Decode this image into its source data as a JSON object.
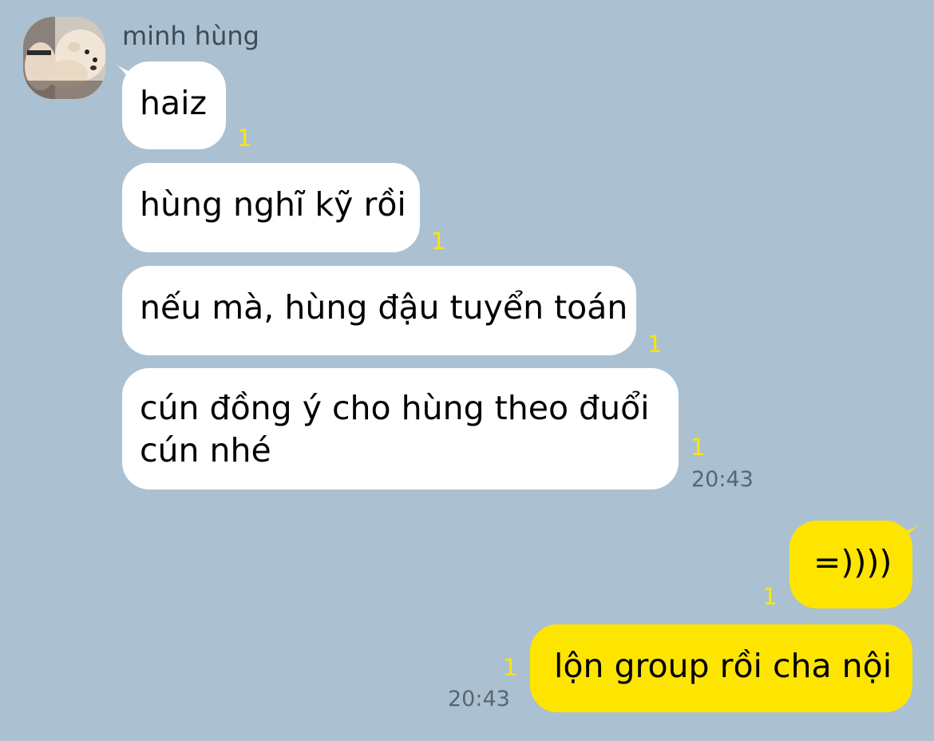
{
  "chat": {
    "sender_name": "minh hùng",
    "incoming": [
      {
        "text": "haiz",
        "unread": "1"
      },
      {
        "text": "hùng nghĩ kỹ rồi",
        "unread": "1"
      },
      {
        "text": "nếu mà, hùng đậu tuyển toán",
        "unread": "1"
      },
      {
        "text": "cún đồng ý cho hùng theo đuổi",
        "text2": "cún nhé",
        "unread": "1",
        "time": "20:43"
      }
    ],
    "outgoing": [
      {
        "text": "=))))",
        "unread": "1"
      },
      {
        "text": "lộn group rồi cha nội",
        "unread": "1",
        "time": "20:43"
      }
    ]
  },
  "colors": {
    "background": "#abc1d1",
    "incoming_bubble": "#ffffff",
    "outgoing_bubble": "#fee500",
    "unread_count": "#fee500"
  },
  "icons": {
    "avatar": "profile-photo-with-dog"
  }
}
